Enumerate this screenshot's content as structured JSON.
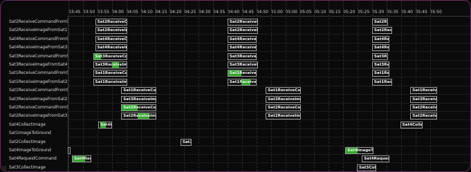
{
  "timeline": {
    "ticks": [
      {
        "i": 0,
        "label": "03:45"
      },
      {
        "i": 1,
        "label": "03:50"
      },
      {
        "i": 2,
        "label": "03:55"
      },
      {
        "i": 3,
        "label": "04:00"
      },
      {
        "i": 4,
        "label": "04:05"
      },
      {
        "i": 5,
        "label": "04:10"
      },
      {
        "i": 6,
        "label": "04:15"
      },
      {
        "i": 7,
        "label": "04:20"
      },
      {
        "i": 8,
        "label": "04:25"
      },
      {
        "i": 9,
        "label": "04:30"
      },
      {
        "i": 10,
        "label": "04:35"
      },
      {
        "i": 11,
        "label": "04:40"
      },
      {
        "i": 12,
        "label": "04:45"
      },
      {
        "i": 13,
        "label": "04:50"
      },
      {
        "i": 14,
        "label": "01:00"
      },
      {
        "i": 15,
        "label": "05:00"
      },
      {
        "i": 16,
        "label": "05:05"
      },
      {
        "i": 17,
        "label": "05:10"
      },
      {
        "i": 18,
        "label": "05:15"
      },
      {
        "i": 19,
        "label": "05:20"
      },
      {
        "i": 20,
        "label": "05:25"
      },
      {
        "i": 21,
        "label": "05:30"
      },
      {
        "i": 22,
        "label": "05:35"
      },
      {
        "i": 23,
        "label": "05:40"
      },
      {
        "i": 24,
        "label": "05:45"
      },
      {
        "i": 25,
        "label": "05:50"
      }
    ]
  },
  "rows": [
    {
      "label": "Sat2ReceiveCommandFromSat1",
      "tasks": [
        {
          "start": 1.85,
          "end": 4.05,
          "text": "Sat2ReceiveComma"
        },
        {
          "start": 11.0,
          "end": 13.1,
          "text": "Sat2ReceiveComma"
        },
        {
          "start": 21.0,
          "end": 22.1,
          "text": "Sat2ReceiveComma"
        }
      ]
    },
    {
      "label": "Sat2ReceiveImageFromSat1",
      "tasks": [
        {
          "start": 1.85,
          "end": 4.05,
          "text": "Sat2ReceiveImageF"
        },
        {
          "start": 11.0,
          "end": 13.1,
          "text": "Sat2ReceiveImageF"
        },
        {
          "start": 21.0,
          "end": 22.4,
          "text": "Sat2ReceiveImageF"
        }
      ]
    },
    {
      "label": "Sat4ReceiveCommandFromSat3",
      "tasks": [
        {
          "start": 1.85,
          "end": 4.05,
          "text": "Sat4ReceiveComma"
        },
        {
          "start": 11.0,
          "end": 13.0,
          "text": "Sat4ReceiveComma"
        },
        {
          "start": 21.0,
          "end": 22.2,
          "text": "Sat4ReceiveComma"
        }
      ]
    },
    {
      "label": "Sat4ReceiveImageFromSat3",
      "tasks": [
        {
          "start": 1.85,
          "end": 4.05,
          "text": "Sat4ReceiveImageF"
        },
        {
          "start": 11.0,
          "end": 13.0,
          "text": "Sat4ReceiveImageI"
        },
        {
          "start": 21.0,
          "end": 22.2,
          "text": "Sat4ReceiveImage"
        }
      ]
    },
    {
      "label": "Sat3ReceiveCommandFromSat4",
      "tasks": [
        {
          "start": 1.7,
          "end": 4.05,
          "text": "Sat3ReceiveComma",
          "hl": [
            {
              "from": 0,
              "to": 0.22
            }
          ]
        },
        {
          "start": 11.0,
          "end": 13.0,
          "text": "Sat3ReceiveComma"
        },
        {
          "start": 21.0,
          "end": 22.1,
          "text": "Sat3ReceiveComma"
        }
      ]
    },
    {
      "label": "Sat3ReceiveImageFromSat4",
      "tasks": [
        {
          "start": 1.7,
          "end": 4.05,
          "text": "Sat3ReceiveImageF",
          "hl": [
            {
              "from": 0.54,
              "to": 0.75
            }
          ]
        },
        {
          "start": 11.0,
          "end": 13.1,
          "text": "Sat3ReceiveImageI"
        },
        {
          "start": 21.0,
          "end": 22.2,
          "text": "Sat3ReceiveImage"
        }
      ]
    },
    {
      "label": "Sat1ReceiveCommandFromSat2",
      "tasks": [
        {
          "start": 1.7,
          "end": 4.05,
          "text": "Sat1ReceiveComma"
        },
        {
          "start": 11.0,
          "end": 13.0,
          "text": "Sat1ReceiveComma",
          "hl": [
            {
              "from": 0,
              "to": 0.45
            }
          ]
        },
        {
          "start": 21.0,
          "end": 22.2,
          "text": "Sat1ReceiveComma"
        }
      ]
    },
    {
      "label": "Sat1ReceiveImageFromSat2",
      "tasks": [
        {
          "start": 1.7,
          "end": 4.05,
          "text": "Sat1ReceiveImageF"
        },
        {
          "start": 11.0,
          "end": 13.0,
          "text": "Sat1ReceiveImageF",
          "hl": [
            {
              "from": 0.45,
              "to": 0.78
            }
          ]
        },
        {
          "start": 21.0,
          "end": 22.4,
          "text": "Sat1ReceiveImageF"
        }
      ]
    },
    {
      "label": "Sat1ReceiveCommandFromSat2",
      "tasks": [
        {
          "start": 3.65,
          "end": 6.1,
          "text": "Sat1ReceiveComma"
        },
        {
          "start": 13.65,
          "end": 16.1,
          "text": "Sat1ReceiveComma"
        },
        {
          "start": 23.65,
          "end": 25.5,
          "text": "Sat1ReceiveComma"
        }
      ]
    },
    {
      "label": "Sat3ReceiveImageFromSat2",
      "tasks": [
        {
          "start": 3.65,
          "end": 6.1,
          "text": "Sat3ReceiveImageI"
        },
        {
          "start": 13.65,
          "end": 16.1,
          "text": "Sat3ReceiveImageI"
        },
        {
          "start": 23.65,
          "end": 25.5,
          "text": "Sat3ReceiveImageI"
        }
      ]
    },
    {
      "label": "Sat2ReceiveCommandFromSat3",
      "tasks": [
        {
          "start": 3.65,
          "end": 6.1,
          "text": "Sat2ReceiveComma",
          "hl": [
            {
              "from": 0,
              "to": 0.45
            }
          ]
        },
        {
          "start": 13.65,
          "end": 16.1,
          "text": "Sat2ReceiveComma"
        },
        {
          "start": 23.65,
          "end": 25.5,
          "text": "Sat2ReceiveComma"
        }
      ]
    },
    {
      "label": "Sat2ReceiveImageFromSat3",
      "tasks": [
        {
          "start": 3.65,
          "end": 6.1,
          "text": "Sat2ReceiveImageI",
          "hl": [
            {
              "from": 0.45,
              "to": 0.78
            }
          ]
        },
        {
          "start": 13.65,
          "end": 16.1,
          "text": "Sat2ReceiveImageI"
        },
        {
          "start": 23.65,
          "end": 25.5,
          "text": "Sat2ReceiveImageI"
        }
      ]
    },
    {
      "label": "Sat4CollectImage",
      "tasks": [
        {
          "start": 2.05,
          "end": 3.0,
          "text": "Sat4CollectIma",
          "hl": [
            {
              "from": 0.12,
              "to": 0.52
            }
          ]
        },
        {
          "start": 22.95,
          "end": 24.5,
          "text": "Sat4CollectIm"
        }
      ]
    },
    {
      "label": "Sat1ImageToGround",
      "tasks": []
    },
    {
      "label": "Sat2CollectImage",
      "tasks": [
        {
          "start": 7.75,
          "end": 8.5,
          "text": "Sat2Coll"
        }
      ]
    },
    {
      "label": "Sat4ImageToGround",
      "tasks": [
        {
          "start": -0.1,
          "end": 0.05,
          "text": "Sat4"
        },
        {
          "start": 19.15,
          "end": 21.1,
          "text": "Sat4ImageToGround",
          "hl": [
            {
              "from": 0,
              "to": 0.4
            }
          ]
        }
      ]
    },
    {
      "label": "Sat4RequestCommand",
      "tasks": [
        {
          "start": 0.25,
          "end": 1.6,
          "text": "Sat4Reque",
          "hl": [
            {
              "from": 0,
              "to": 0.62
            }
          ]
        },
        {
          "start": 20.3,
          "end": 22.2,
          "text": "Sat4RequestCom"
        }
      ]
    },
    {
      "label": "Sat3CollectImage",
      "tasks": [
        {
          "start": 19.95,
          "end": 21.3,
          "text": "Sat3CollectIma"
        }
      ]
    },
    {
      "label": "Sat2RequestCommand",
      "tasks": [
        {
          "start": 25.25,
          "end": 26.2,
          "text": "Sat2Reque"
        }
      ]
    }
  ],
  "colors": {
    "frame_border": "#6a2f63",
    "background": "#0a0a0a",
    "bar_border": "#9a9a9a",
    "bar_fill": "#111111",
    "highlight": "#2fa92a"
  }
}
